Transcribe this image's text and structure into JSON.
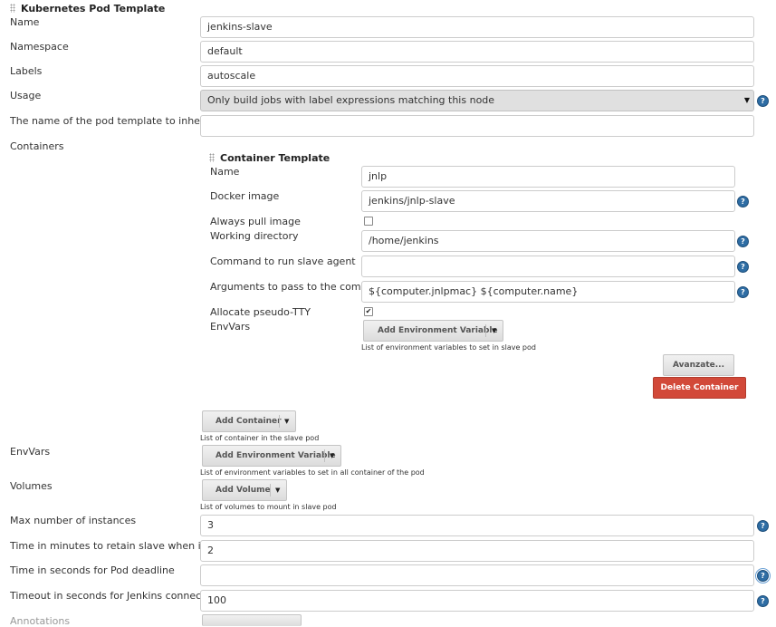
{
  "pod_template": {
    "section_title": "Kubernetes Pod Template",
    "name_label": "Name",
    "name_value": "jenkins-slave",
    "namespace_label": "Namespace",
    "namespace_value": "default",
    "labels_label": "Labels",
    "labels_value": "autoscale",
    "usage_label": "Usage",
    "usage_value": "Only build jobs with label expressions matching this node",
    "inherit_label": "The name of the pod template to inherit from",
    "inherit_value": "",
    "containers_label": "Containers"
  },
  "container_template": {
    "section_title": "Container Template",
    "name_label": "Name",
    "name_value": "jnlp",
    "docker_image_label": "Docker image",
    "docker_image_value": "jenkins/jnlp-slave",
    "always_pull_label": "Always pull image",
    "always_pull_checked": false,
    "working_dir_label": "Working directory",
    "working_dir_value": "/home/jenkins",
    "command_label": "Command to run slave agent",
    "command_value": "",
    "args_label": "Arguments to pass to the command",
    "args_value": "${computer.jnlpmac} ${computer.name}",
    "tty_label": "Allocate pseudo-TTY",
    "tty_checked": true,
    "tty_mark": "✔",
    "envvars_label": "EnvVars",
    "add_env_button": "Add Environment Variable",
    "env_hint": "List of environment variables to set in slave pod",
    "advanced_button": "Avanzate...",
    "delete_button": "Delete Container"
  },
  "add_container_button": "Add Container",
  "containers_hint": "List of container in the slave pod",
  "envvars_label": "EnvVars",
  "add_env_button": "Add Environment Variable",
  "envvars_hint": "List of environment variables to set in all container of the pod",
  "volumes_label": "Volumes",
  "add_volume_button": "Add Volume",
  "volumes_hint": "List of volumes to mount in slave pod",
  "max_instances_label": "Max number of instances",
  "max_instances_value": "3",
  "retain_idle_label": "Time in minutes to retain slave when idle",
  "retain_idle_value": "2",
  "pod_deadline_label": "Time in seconds for Pod deadline",
  "pod_deadline_value": "",
  "timeout_label": "Timeout in seconds for Jenkins connection",
  "timeout_value": "100",
  "annotations_label": "Annotations",
  "help_glyph": "?",
  "caret_glyph": "▼",
  "colors": {
    "help_blue": "#2e6da4",
    "delete_red": "#d24939",
    "select_bg": "#e0e0e0",
    "border": "#cccccc"
  }
}
